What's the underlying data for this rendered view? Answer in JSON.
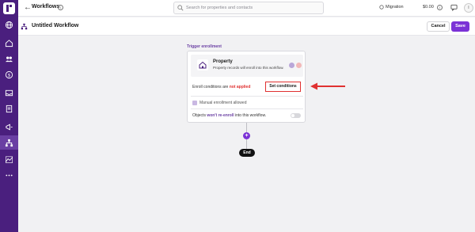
{
  "topbar": {
    "breadcrumb": "Workflows",
    "search_placeholder": "Search for properties and contacts",
    "migration_label": "Migration",
    "credits_label": "$0.00"
  },
  "titlebar": {
    "title": "Untitled Workflow",
    "cancel_label": "Cancel",
    "save_label": "Save"
  },
  "trigger": {
    "section_label": "Trigger enrollment",
    "object_title": "Property",
    "object_desc": "Property records will enroll into this workflow.",
    "enroll_prefix": "Enroll conditions are ",
    "enroll_status": "not applied",
    "set_conditions_label": "Set conditions",
    "manual_label": "Manual enrollment allowed",
    "reenroll_prefix": "Objects ",
    "reenroll_emph": "won't re-enroll",
    "reenroll_suffix": " into this workflow."
  },
  "flow": {
    "end_label": "End"
  },
  "colors": {
    "sidebar": "#4a1f7e",
    "accent": "#7b32d6",
    "warning": "#e03131"
  }
}
